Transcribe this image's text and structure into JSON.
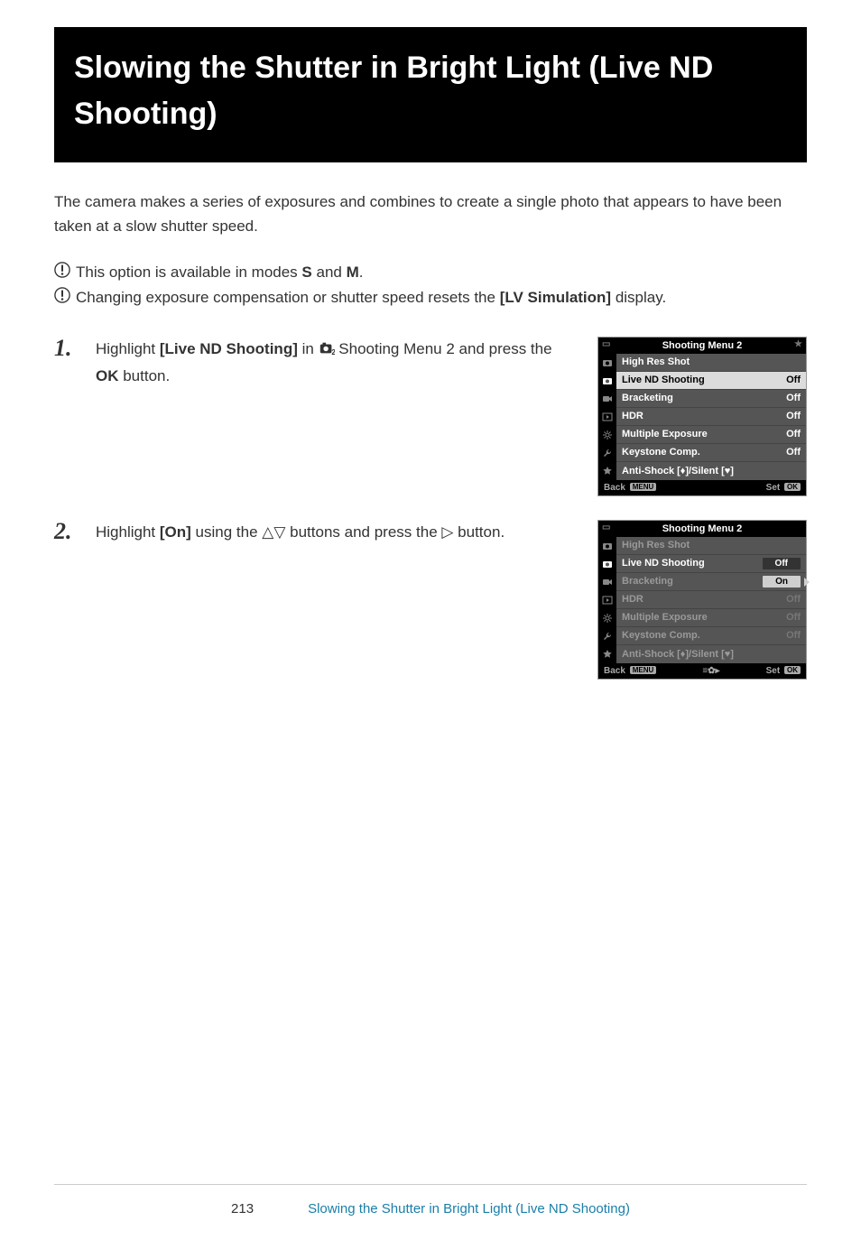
{
  "title": "Slowing the Shutter in Bright Light (Live ND Shooting)",
  "intro": "The camera makes a series of exposures and combines to create a single photo that appears to have been taken at a slow shutter speed.",
  "cautions": [
    {
      "pre": "This option is available in modes ",
      "b1": "S",
      "mid": " and ",
      "b2": "M",
      "post": "."
    },
    {
      "pre": "Changing exposure compensation or shutter speed resets the ",
      "b1": "[LV Simulation]",
      "mid": "",
      "b2": "",
      "post": " display."
    }
  ],
  "steps": [
    {
      "num": "1.",
      "pre": "Highlight ",
      "bold1": "[Live ND Shooting]",
      "mid1": " in ",
      "mid2": " Shooting Menu 2 and press the ",
      "bold2": "OK",
      "post": " button."
    },
    {
      "num": "2.",
      "pre": "Highlight ",
      "bold1": "[On]",
      "mid1": " using the ",
      "arrows1": "△▽",
      "mid2": " buttons and press the ",
      "arrows2": "▷",
      "post": " button."
    }
  ],
  "menu1": {
    "title": "Shooting Menu 2",
    "rows": [
      {
        "label": "High Res Shot",
        "val": "",
        "hl": false,
        "dim": false
      },
      {
        "label": "Live ND Shooting",
        "val": "Off",
        "hl": true,
        "dim": false
      },
      {
        "label": "Bracketing",
        "val": "Off",
        "hl": false,
        "dim": false
      },
      {
        "label": "HDR",
        "val": "Off",
        "hl": false,
        "dim": false
      },
      {
        "label": "Multiple Exposure",
        "val": "Off",
        "hl": false,
        "dim": false
      },
      {
        "label": "Keystone Comp.",
        "val": "Off",
        "hl": false,
        "dim": false
      },
      {
        "label": "Anti-Shock [♦]/Silent [♥]",
        "val": "",
        "hl": false,
        "dim": false
      }
    ],
    "back": "Back",
    "backTag": "MENU",
    "set": "Set",
    "setTag": "OK"
  },
  "menu2": {
    "title": "Shooting Menu 2",
    "rows": [
      {
        "label": "High Res Shot",
        "val": "",
        "hl": false,
        "dim": true
      },
      {
        "label": "Live ND Shooting",
        "val": "Off",
        "hl": false,
        "dim": false,
        "valbox": true
      },
      {
        "label": "Bracketing",
        "val": "On",
        "hl": false,
        "dim": true,
        "selbox": true
      },
      {
        "label": "HDR",
        "val": "Off",
        "hl": false,
        "dim": true
      },
      {
        "label": "Multiple Exposure",
        "val": "Off",
        "hl": false,
        "dim": true
      },
      {
        "label": "Keystone Comp.",
        "val": "Off",
        "hl": false,
        "dim": true
      },
      {
        "label": "Anti-Shock [♦]/Silent [♥]",
        "val": "",
        "hl": false,
        "dim": true
      }
    ],
    "back": "Back",
    "backTag": "MENU",
    "midIcon": "≡✿▸",
    "set": "Set",
    "setTag": "OK"
  },
  "footer": {
    "page": "213",
    "link": "Slowing the Shutter in Bright Light (Live ND Shooting)"
  }
}
